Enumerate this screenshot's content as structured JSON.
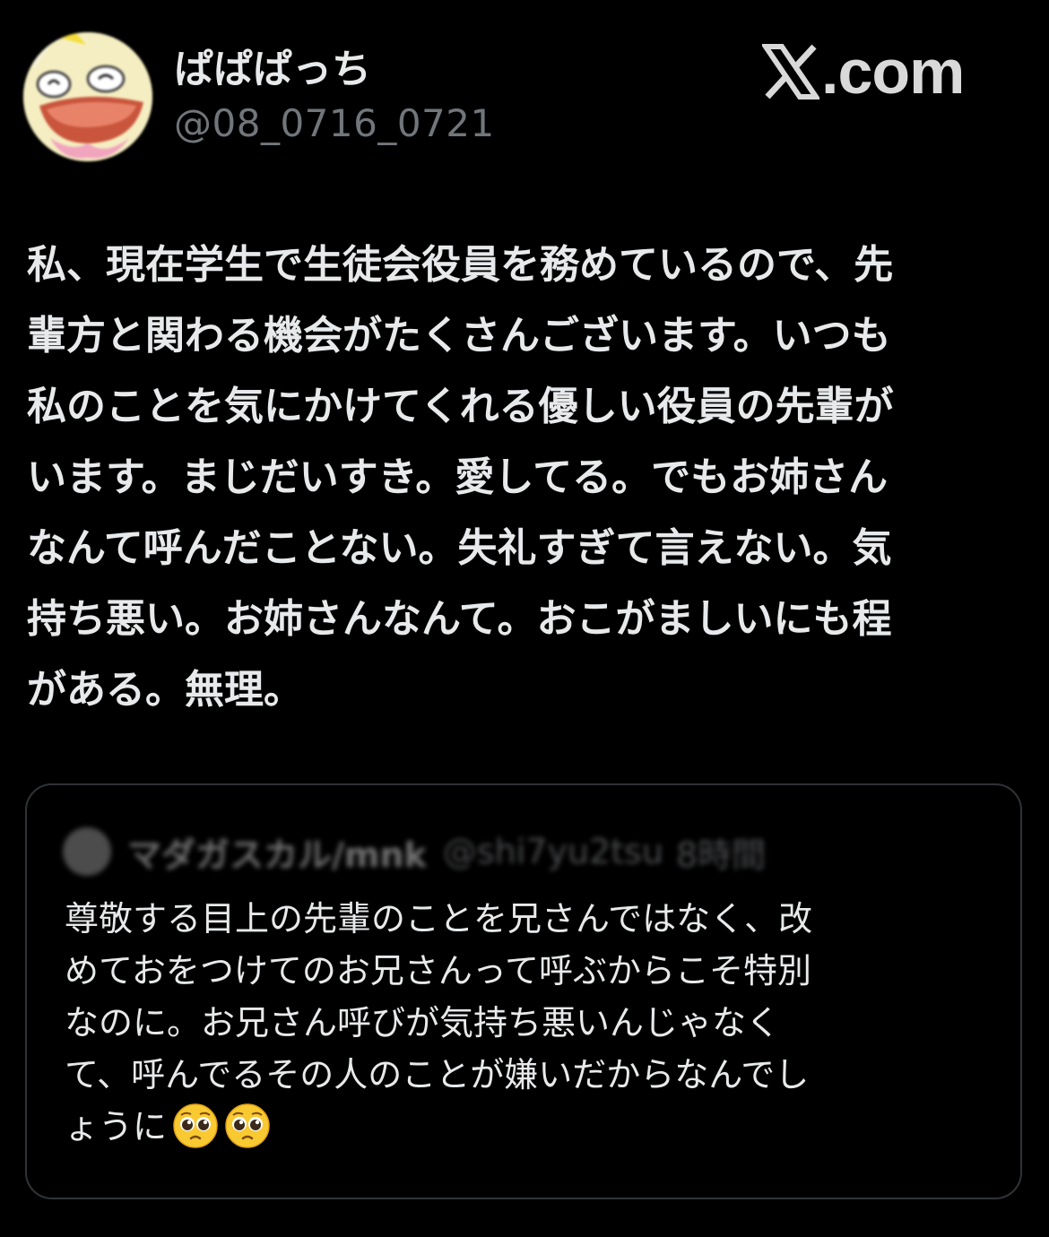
{
  "watermark": {
    "logo_icon": "x-logo-icon",
    "text": ".com"
  },
  "author": {
    "avatar_icon": "cartoon-face-avatar",
    "display_name": "ぱぱぱっち",
    "handle": "@08_0716_0721"
  },
  "tweet": {
    "lines": [
      "私、現在学生で生徒会役員を務めているので、先",
      "輩方と関わる機会がたくさんございます。いつも",
      "私のことを気にかけてくれる優しい役員の先輩が",
      "います。まじだいすき。愛してる。でもお姉さん",
      "なんて呼んだことない。失礼すぎて言えない。気",
      "持ち悪い。お姉さんなんて。おこがましいにも程",
      "がある。無理。"
    ]
  },
  "quoted_tweet": {
    "display_name": "マダガスカル/mnk",
    "handle": "@shi7yu2tsu",
    "time": "8時間",
    "lines": [
      "尊敬する目上の先輩のことを兄さんではなく、改",
      "めておをつけてのお兄さんって呼ぶからこそ特別",
      "なのに。お兄さん呼びが気持ち悪いんじゃなく",
      "て、呼んでるその人のことが嫌いだからなんでし",
      "ょうに"
    ],
    "trailing_emojis": [
      "pleading-face-emoji",
      "pleading-face-emoji"
    ]
  },
  "colors": {
    "background": "#000000",
    "primary_text": "#e7e9ea",
    "secondary_text": "#71767b",
    "card_border": "#2f3336"
  }
}
